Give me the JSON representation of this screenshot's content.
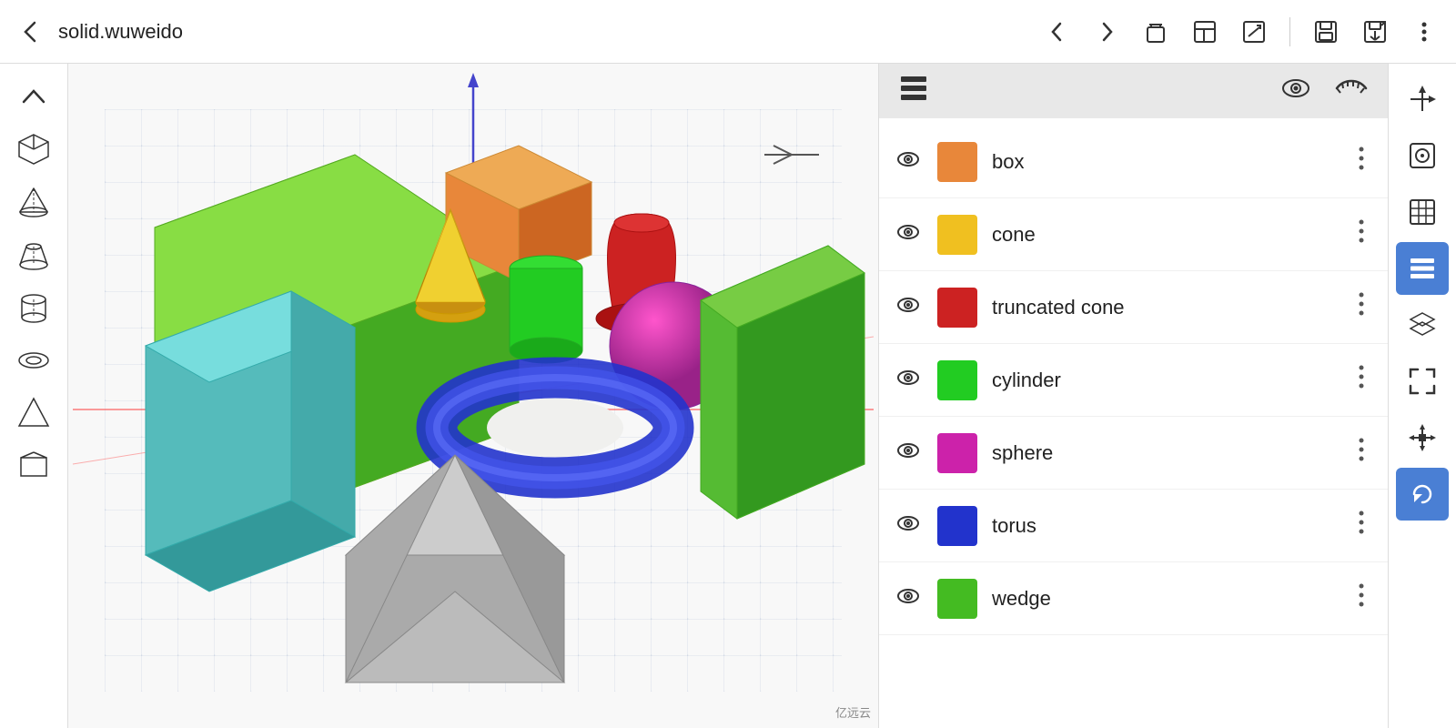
{
  "header": {
    "back_label": "←",
    "title": "solid.wuweido",
    "toolbar": {
      "back": "←",
      "forward": "→",
      "delete": "🗑",
      "add_view": "⊞",
      "edit": "✏",
      "save": "💾",
      "export": "📤",
      "more": "⋮"
    }
  },
  "left_sidebar": {
    "tools": [
      {
        "name": "collapse",
        "icon": "∧",
        "id": "collapse-tool"
      },
      {
        "name": "box-tool",
        "icon": "□",
        "id": "box-tool"
      },
      {
        "name": "triangle-tool",
        "icon": "△",
        "id": "triangle-tool"
      },
      {
        "name": "truncated-cone-tool",
        "icon": "⌣",
        "id": "truncated-cone-tool"
      },
      {
        "name": "cylinder-tool",
        "icon": "⊓",
        "id": "cylinder-tool"
      },
      {
        "name": "torus-tool",
        "icon": "◎",
        "id": "torus-tool"
      },
      {
        "name": "wedge-tool",
        "icon": "◁",
        "id": "wedge-tool"
      },
      {
        "name": "prism-tool",
        "icon": "◇",
        "id": "prism-tool"
      }
    ]
  },
  "canvas": {
    "grid_visible": true,
    "shapes": [
      {
        "type": "box",
        "color": "#e8873a"
      },
      {
        "type": "cone",
        "color": "#f0c020"
      },
      {
        "type": "truncated_cone",
        "color": "#cc2222"
      },
      {
        "type": "cylinder",
        "color": "#22cc22"
      },
      {
        "type": "sphere",
        "color": "#cc22aa"
      },
      {
        "type": "torus",
        "color": "#2233cc"
      },
      {
        "type": "wedge",
        "color": "#44bb22"
      },
      {
        "type": "large_box",
        "color": "#44bb22"
      },
      {
        "type": "pyramid",
        "color": "#9999aa"
      }
    ]
  },
  "panel": {
    "header_icon": "≡",
    "eye_open": "👁",
    "eye_closed": "⌒",
    "layers": [
      {
        "name": "box",
        "color": "#e8873a",
        "visible": true
      },
      {
        "name": "cone",
        "color": "#f0c020",
        "visible": true
      },
      {
        "name": "truncated cone",
        "color": "#cc2222",
        "visible": true
      },
      {
        "name": "cylinder",
        "color": "#22cc22",
        "visible": true
      },
      {
        "name": "sphere",
        "color": "#cc22aa",
        "visible": true
      },
      {
        "name": "torus",
        "color": "#2233cc",
        "visible": true
      },
      {
        "name": "wedge",
        "color": "#44bb22",
        "visible": true
      }
    ]
  },
  "far_right": {
    "tools": [
      {
        "name": "3d-axis",
        "icon": "⊕",
        "active": false
      },
      {
        "name": "search-view",
        "icon": "⊙",
        "active": false
      },
      {
        "name": "grid-view",
        "icon": "⊞",
        "active": false
      },
      {
        "name": "layers-view",
        "icon": "≡",
        "active": true
      },
      {
        "name": "stack-view",
        "icon": "⊗",
        "active": false
      },
      {
        "name": "frame-view",
        "icon": "⌐",
        "active": false
      },
      {
        "name": "move-tool",
        "icon": "⊕",
        "active": false
      },
      {
        "name": "rotate-tool",
        "icon": "↺",
        "active": true
      }
    ]
  },
  "watermark": "亿远云"
}
